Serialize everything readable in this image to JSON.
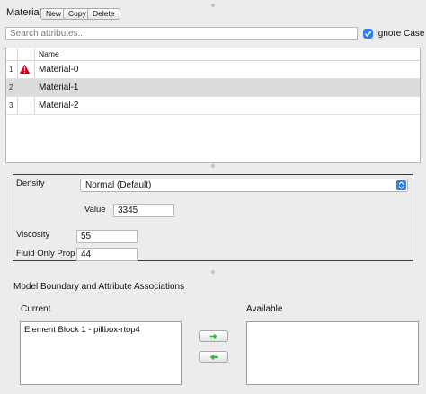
{
  "material_panel": {
    "title": "Material",
    "buttons": {
      "new": "New",
      "copy": "Copy",
      "delete": "Delete"
    },
    "search_placeholder": "Search attributes...",
    "ignore_case_label": "Ignore Case",
    "ignore_case_checked": true
  },
  "table": {
    "columns": [
      "",
      "",
      "Name"
    ],
    "rows": [
      {
        "index": "1",
        "warning_icon": true,
        "name": "Material-0",
        "selected": false
      },
      {
        "index": "2",
        "warning_icon": false,
        "name": "Material-1",
        "selected": true
      },
      {
        "index": "3",
        "warning_icon": false,
        "name": "Material-2",
        "selected": false
      }
    ]
  },
  "properties": {
    "density": {
      "label": "Density",
      "selected_option": "Normal (Default)"
    },
    "value": {
      "label": "Value",
      "value": "3345"
    },
    "viscosity": {
      "label": "Viscosity",
      "value": "55"
    },
    "fluid_only_prop": {
      "label": "Fluid Only Prop",
      "value": "44"
    }
  },
  "associations": {
    "title": "Model Boundary and Attribute Associations",
    "current_label": "Current",
    "available_label": "Available",
    "current_items": [
      "Element Block 1 - pillbox-rtop4"
    ],
    "available_items": []
  },
  "colors": {
    "accent": "#2f7cf6",
    "warning": "#d0021b",
    "arrow_green": "#3cb043",
    "selected_row": "#dcdcdc"
  }
}
